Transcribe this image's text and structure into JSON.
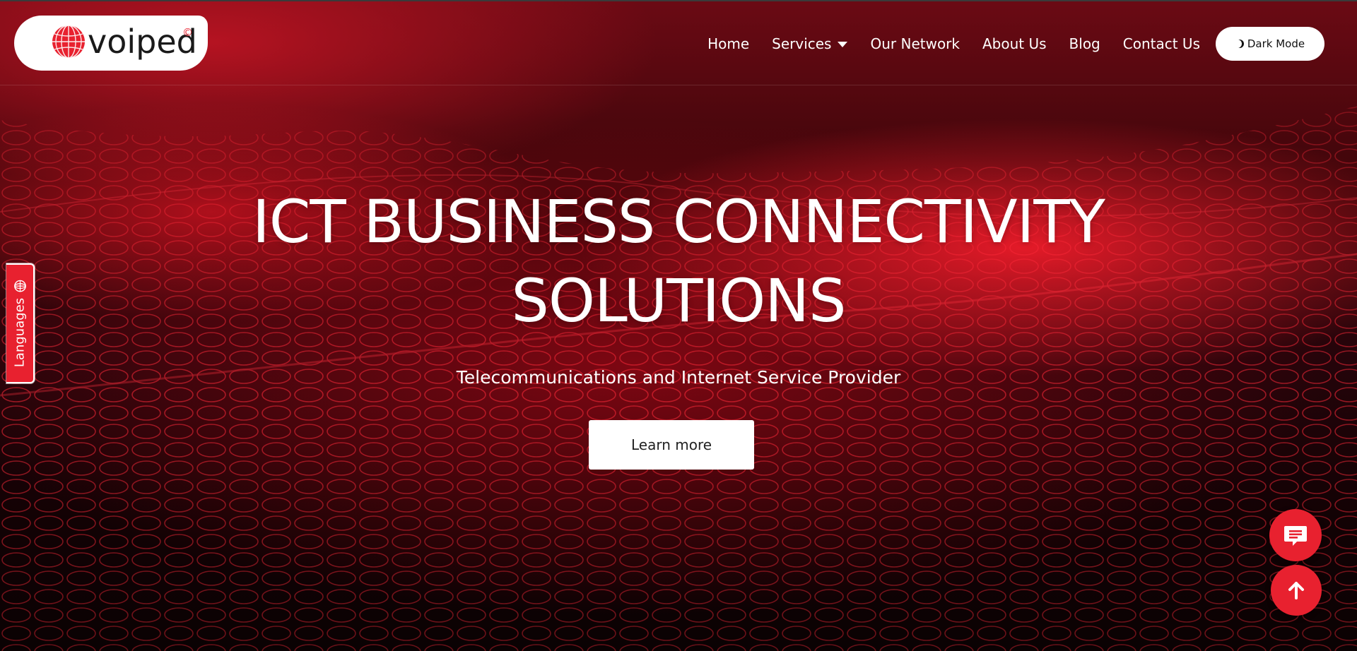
{
  "brand": {
    "logo_text": "voiped",
    "logo_mark": "©",
    "accent_color": "#e8212f"
  },
  "nav": {
    "items": [
      {
        "label": "Home"
      },
      {
        "label": "Services",
        "has_dropdown": true
      },
      {
        "label": "Our Network"
      },
      {
        "label": "About Us"
      },
      {
        "label": "Blog"
      },
      {
        "label": "Contact Us"
      }
    ],
    "dark_mode_label": "Dark Mode"
  },
  "hero": {
    "title_line1": "ICT BUSINESS CONNECTIVITY",
    "title_line2": "SOLUTIONS",
    "subtitle": "Telecommunications and Internet Service Provider",
    "cta_label": "Learn more"
  },
  "languages_tab": {
    "label": "Languages",
    "icon": "globe-icon"
  },
  "floating": {
    "chat_icon": "chat-bubble-icon",
    "scroll_top_icon": "arrow-up-icon"
  }
}
